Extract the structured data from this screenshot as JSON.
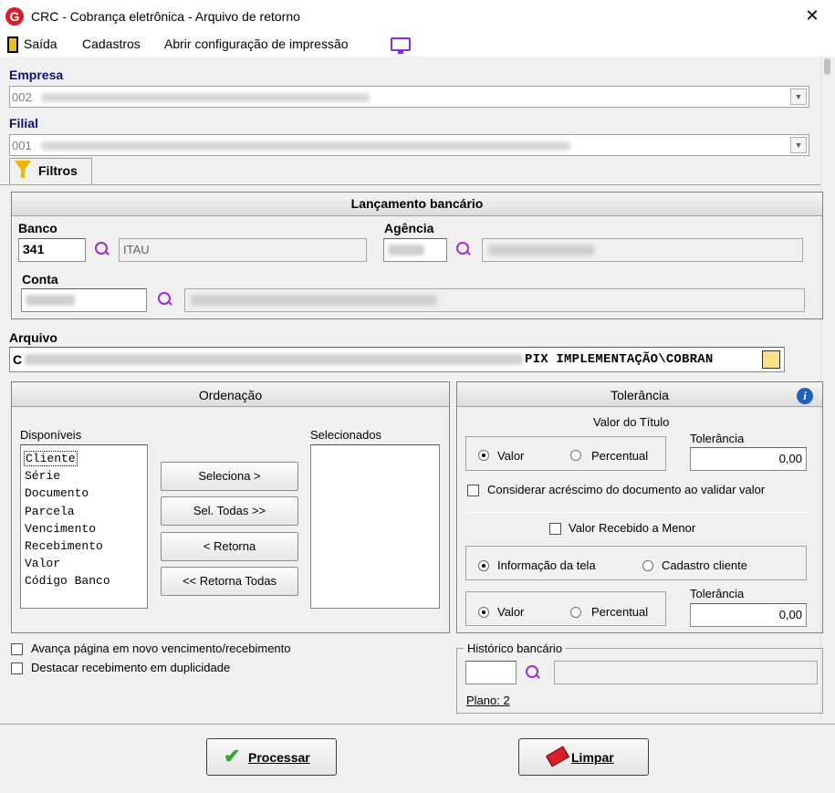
{
  "window": {
    "title": "CRC - Cobrança eletrônica - Arquivo de retorno",
    "close": "✕",
    "logo": "G"
  },
  "menu": {
    "exit": "Saída",
    "registers": "Cadastros",
    "print_config": "Abrir configuração de impressão"
  },
  "empresa": {
    "label": "Empresa",
    "value": "002"
  },
  "filial": {
    "label": "Filial",
    "value": "001"
  },
  "tab": {
    "label": "Filtros"
  },
  "lancamento": {
    "title": "Lançamento bancário",
    "banco_label": "Banco",
    "banco_code": "341",
    "banco_name": "ITAU",
    "agencia_label": "Agência",
    "conta_label": "Conta"
  },
  "arquivo": {
    "label": "Arquivo",
    "prefix": "C",
    "path_visible": "PIX IMPLEMENTAÇÃO\\COBRAN"
  },
  "ordenacao": {
    "title": "Ordenação",
    "available_label": "Disponíveis",
    "selected_label": "Selecionados",
    "available": [
      "Cliente",
      "Série",
      "Documento",
      "Parcela",
      "Vencimento",
      "Recebimento",
      "Valor",
      "Código Banco"
    ],
    "btn_select": "Seleciona >",
    "btn_select_all": "Sel. Todas >>",
    "btn_return": "< Retorna",
    "btn_return_all": "<< Retorna Todas"
  },
  "tolerancia": {
    "title": "Tolerância",
    "valor_titulo": "Valor do Título",
    "tol_label": "Tolerância",
    "radio_valor": "Valor",
    "radio_percentual": "Percentual",
    "tol_value_1": "0,00",
    "considerar": "Considerar acréscimo do documento ao validar valor",
    "valor_recebido_menor": "Valor Recebido a Menor",
    "info_tela": "Informação da tela",
    "cadastro_cliente": "Cadastro cliente",
    "tol_label_2": "Tolerância",
    "radio_valor_2": "Valor",
    "radio_percentual_2": "Percentual",
    "tol_value_2": "0,00"
  },
  "options": {
    "avanca": "Avança página em novo vencimento/recebimento",
    "destacar": "Destacar recebimento em duplicidade"
  },
  "historico": {
    "label": "Histórico bancário",
    "plano": "Plano: 2"
  },
  "actions": {
    "processar": "Processar",
    "limpar": "Limpar"
  }
}
